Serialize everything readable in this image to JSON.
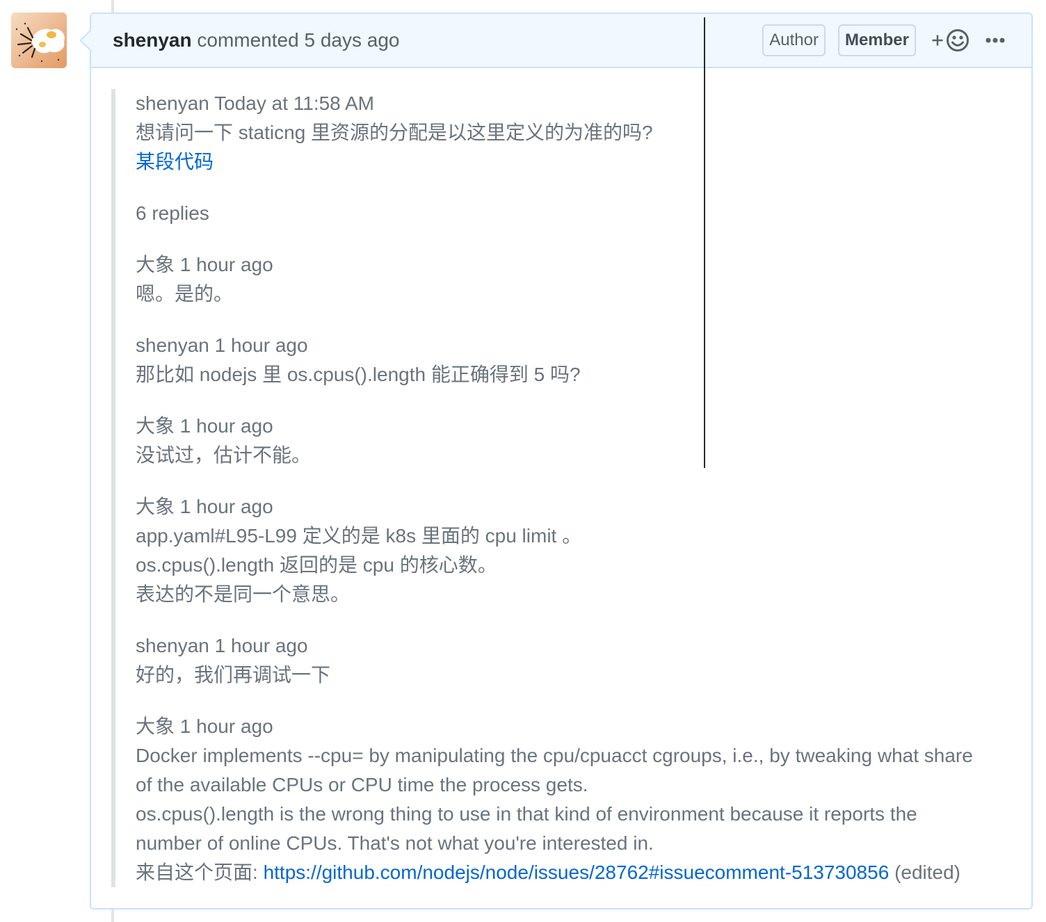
{
  "comment": {
    "author": "shenyan",
    "action": "commented",
    "time": "5 days ago",
    "badges": [
      "Author",
      "Member"
    ]
  },
  "icons": {
    "reaction": "smiley-plus-icon",
    "menu": "kebab-horizontal-icon"
  },
  "quote": {
    "message": {
      "meta": "shenyan Today at 11:58 AM",
      "text": "想请问一下 staticng 里资源的分配是以这里定义的为准的吗?",
      "link": "某段代码"
    },
    "replies_label": "6 replies",
    "replies": [
      {
        "meta": "大象 1 hour ago",
        "lines": [
          "嗯。是的。"
        ]
      },
      {
        "meta": "shenyan 1 hour ago",
        "lines": [
          "那比如 nodejs 里 os.cpus().length 能正确得到 5 吗?"
        ]
      },
      {
        "meta": "大象 1 hour ago",
        "lines": [
          "没试过，估计不能。"
        ]
      },
      {
        "meta": "大象 1 hour ago",
        "lines": [
          "app.yaml#L95-L99 定义的是 k8s 里面的 cpu limit 。",
          "os.cpus().length 返回的是 cpu 的核心数。",
          "表达的不是同一个意思。"
        ]
      },
      {
        "meta": "shenyan 1 hour ago",
        "lines": [
          "好的，我们再调试一下"
        ]
      },
      {
        "meta": "大象 1 hour ago",
        "lines": [
          "Docker implements --cpu= by manipulating the cpu/cpuacct cgroups, i.e., by tweaking what share",
          "of the available CPUs or CPU time the process gets.",
          "os.cpus().length is the wrong thing to use in that kind of environment because it reports the",
          "number of online CPUs. That's not what you're interested in."
        ],
        "source_label": "来自这个页面:",
        "source_url": "https://github.com/nodejs/node/issues/28762#issuecomment-513730856",
        "edited": "(edited)"
      }
    ]
  },
  "colors": {
    "link": "#0366d6",
    "header_bg": "#f1f8ff",
    "border": "#c8e1ff",
    "quote_text": "#6a737d",
    "quote_border": "#dfe2e5",
    "author_name": "#24292e",
    "meta_text": "#586069"
  }
}
